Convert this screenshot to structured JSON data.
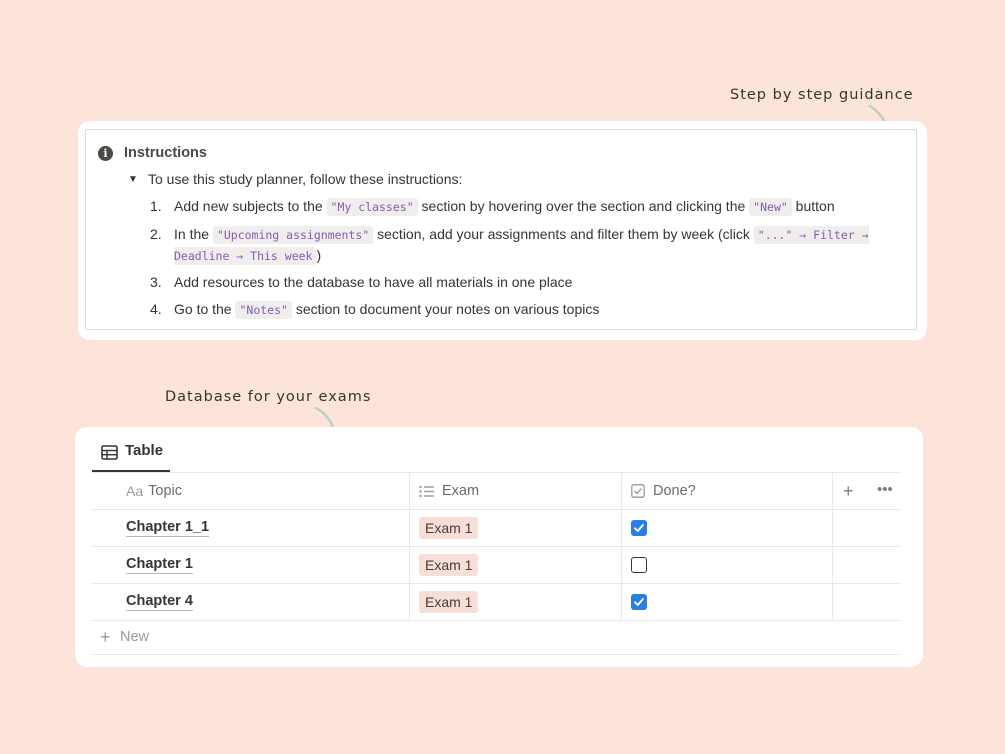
{
  "annotations": {
    "guidance": "Step by step guidance",
    "database": "Database for your exams"
  },
  "callout": {
    "icon": "info-icon",
    "title": "Instructions",
    "toggle_text": "To use this study planner, follow these instructions:",
    "steps": [
      {
        "num": "1.",
        "parts": [
          "Add new subjects to the ",
          "\"My classes\"",
          " section by hovering over the section and clicking the ",
          "\"New\"",
          " button"
        ]
      },
      {
        "num": "2.",
        "parts": [
          "In the ",
          "\"Upcoming assignments\"",
          " section, add your assignments and filter them by week (click ",
          "\"...\" → Filter → Deadline → This week",
          ")"
        ]
      },
      {
        "num": "3.",
        "parts": [
          "Add resources to the database to have all materials in one place"
        ]
      },
      {
        "num": "4.",
        "parts": [
          "Go to the ",
          "\"Notes\"",
          " section to document your notes on various topics"
        ]
      }
    ]
  },
  "database": {
    "view_tab": "Table",
    "columns": {
      "topic_prefix": "Aa",
      "topic": "Topic",
      "exam": "Exam",
      "done": "Done?"
    },
    "add_column": "+",
    "more": "•••",
    "rows": [
      {
        "topic": "Chapter 1_1",
        "exam": "Exam 1",
        "done": true
      },
      {
        "topic": "Chapter 1",
        "exam": "Exam 1",
        "done": false
      },
      {
        "topic": "Chapter 4",
        "exam": "Exam 1",
        "done": true
      }
    ],
    "new_row_label": "New"
  },
  "colors": {
    "background": "#fce4da",
    "checkbox_checked": "#2b7fe0",
    "code_text": "#8a5ab3",
    "pill_bg": "#f6dfd6"
  }
}
